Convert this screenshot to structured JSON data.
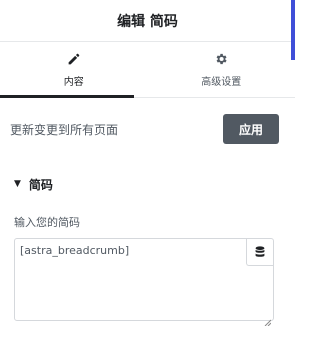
{
  "header": {
    "title": "编辑 简码"
  },
  "tabs": [
    {
      "label": "内容",
      "icon": "pencil-icon",
      "active": true
    },
    {
      "label": "高级设置",
      "icon": "gear-icon",
      "active": false
    }
  ],
  "apply": {
    "text": "更新变更到所有页面",
    "button_label": "应用"
  },
  "section": {
    "title": "简码",
    "expanded": true
  },
  "shortcode": {
    "label": "输入您的简码",
    "value": "[astra_breadcrumb]",
    "dynamic_icon": "database-icon"
  },
  "colors": {
    "accent": "#3f4fd8",
    "button_bg": "#515962",
    "text_dark": "#1f2124",
    "text_muted": "#515962",
    "border": "#d5d8dc"
  }
}
